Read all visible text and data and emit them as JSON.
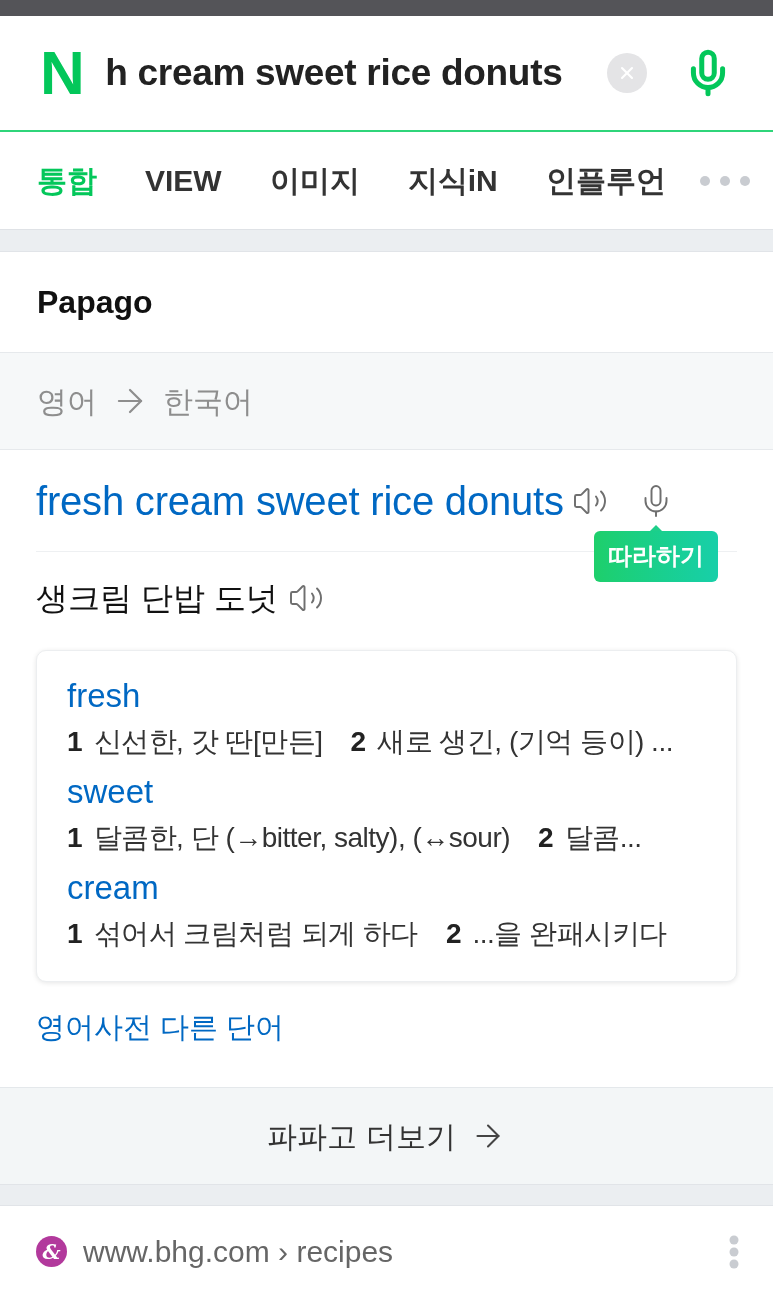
{
  "header": {
    "logo": "N",
    "search": {
      "value": "h cream sweet rice donuts"
    }
  },
  "tabs": [
    {
      "label": "통합",
      "selected": true
    },
    {
      "label": "VIEW",
      "selected": false
    },
    {
      "label": "이미지",
      "selected": false
    },
    {
      "label": "지식iN",
      "selected": false
    },
    {
      "label": "인플루언",
      "selected": false
    }
  ],
  "papago": {
    "title": "Papago",
    "languages": {
      "source": "영어",
      "target": "한국어"
    },
    "source_text": "fresh cream sweet rice donuts",
    "follow_tooltip": "따라하기",
    "translation": "생크림 단밥 도넛",
    "dictionary": [
      {
        "word": "fresh",
        "senses": [
          {
            "number": "1",
            "text": "신선한, 갓 딴[만든]"
          },
          {
            "number": "2",
            "text": "새로 생긴, (기억 등이) ..."
          }
        ]
      },
      {
        "word": "sweet",
        "senses": [
          {
            "number": "1",
            "text": "달콤한, 단 (→bitter, salty), (↔sour)"
          },
          {
            "number": "2",
            "text": "달콤..."
          }
        ]
      },
      {
        "word": "cream",
        "senses": [
          {
            "number": "1",
            "text": "섞어서 크림처럼 되게 하다"
          },
          {
            "number": "2",
            "text": "...을 완패시키다"
          }
        ]
      }
    ],
    "other_words_link": "영어사전 다른 단어",
    "more_button": "파파고 더보기"
  },
  "result": {
    "favicon": "&",
    "url": "www.bhg.com › recipes"
  }
}
